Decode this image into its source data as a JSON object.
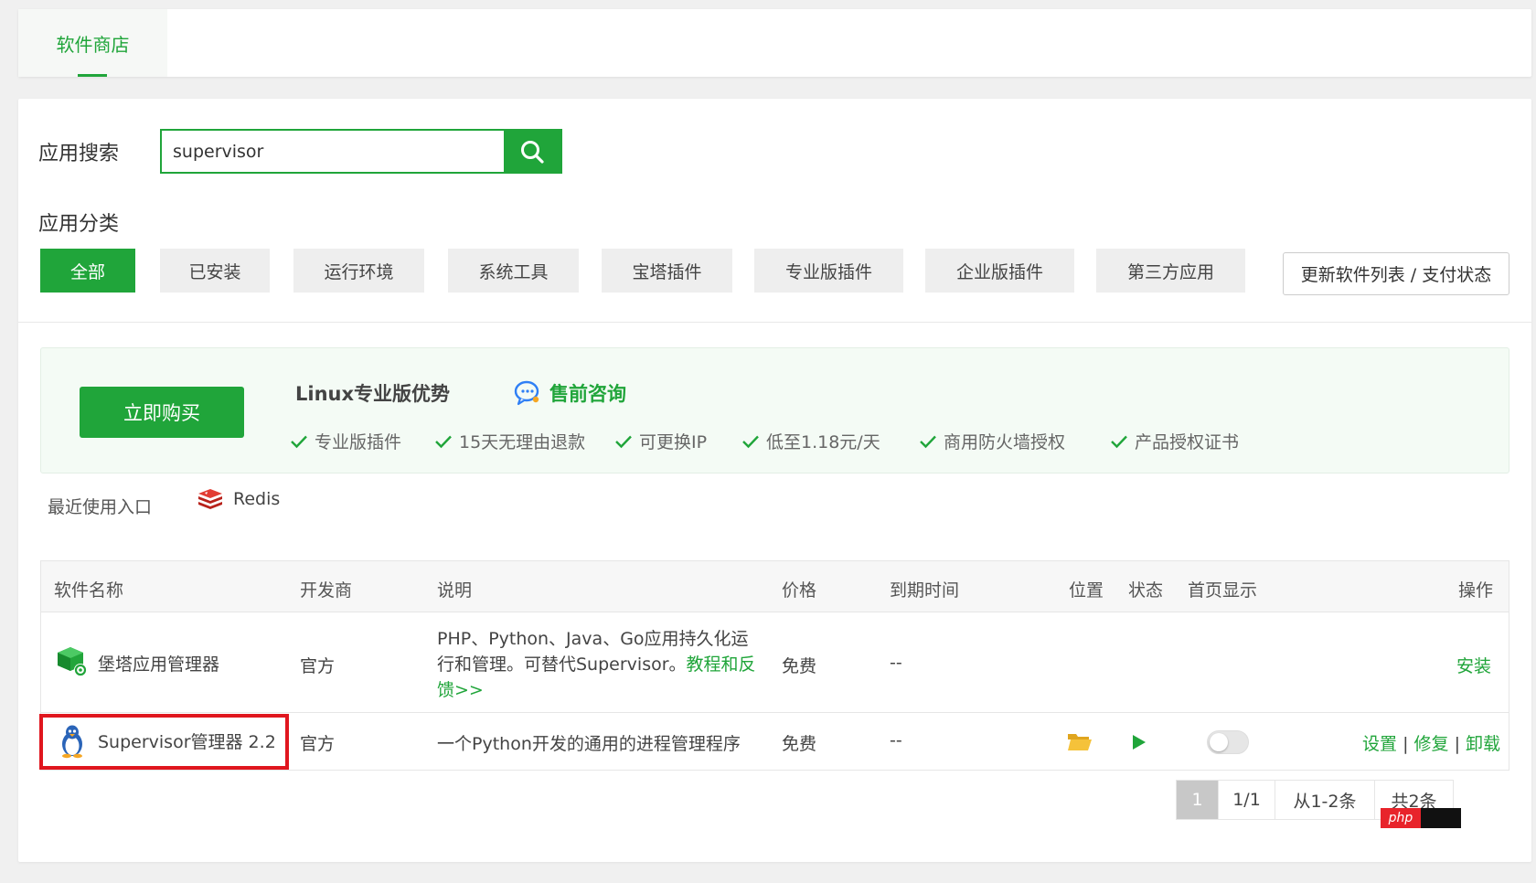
{
  "tab": {
    "label": "软件商店"
  },
  "search": {
    "label": "应用搜索",
    "value": "supervisor"
  },
  "categories": {
    "label": "应用分类",
    "items": [
      "全部",
      "已安装",
      "运行环境",
      "系统工具",
      "宝塔插件",
      "专业版插件",
      "企业版插件",
      "第三方应用"
    ],
    "update_label": "更新软件列表 / 支付状态"
  },
  "promo": {
    "buy_label": "立即购买",
    "title": "Linux专业版优势",
    "consult_label": "售前咨询",
    "features": [
      "专业版插件",
      "15天无理由退款",
      "可更换IP",
      "低至1.18元/天",
      "商用防火墙授权",
      "产品授权证书"
    ]
  },
  "recent": {
    "label": "最近使用入口",
    "item": "Redis"
  },
  "table": {
    "headers": [
      "软件名称",
      "开发商",
      "说明",
      "价格",
      "到期时间",
      "位置",
      "状态",
      "首页显示",
      "操作"
    ],
    "rows": [
      {
        "name": "堡塔应用管理器",
        "vendor": "官方",
        "desc_line1": "PHP、Python、Java、Go应用持久化运",
        "desc_line2": "行和管理。可替代Supervisor。",
        "desc_link1": "教程和反",
        "desc_link2": "馈>>",
        "price": "免费",
        "expire": "--",
        "action": "安装"
      },
      {
        "name": "Supervisor管理器 2.2",
        "vendor": "官方",
        "desc": "一个Python开发的通用的进程管理程序",
        "price": "免费",
        "expire": "--",
        "actions": [
          "设置",
          "修复",
          "卸载"
        ],
        "sep": "|",
        "homepage_on": false
      }
    ]
  },
  "pager": {
    "current": "1",
    "pages": "1/1",
    "range": "从1-2条",
    "total": "共2条"
  },
  "watermark": {
    "text": "php"
  },
  "colors": {
    "accent": "#20a53a",
    "highlight": "#e0161e"
  }
}
